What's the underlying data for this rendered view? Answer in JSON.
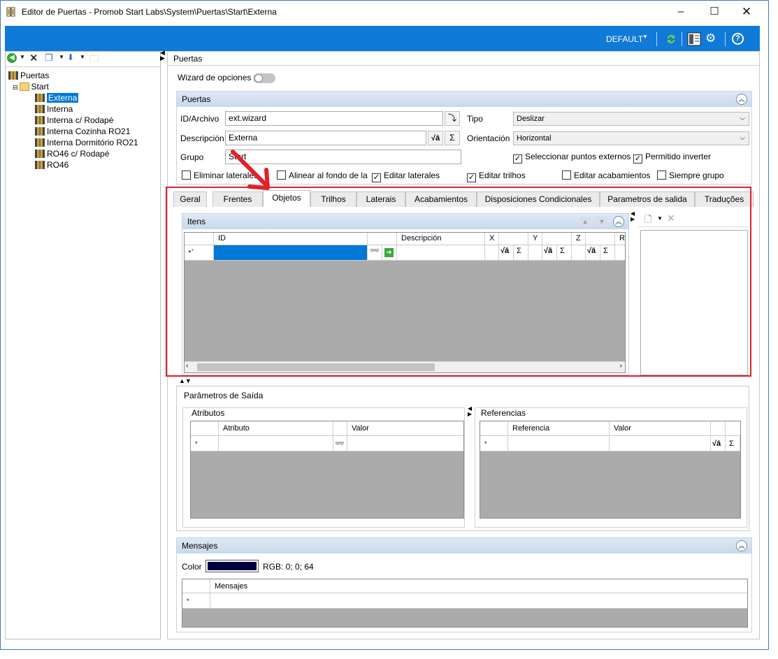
{
  "window": {
    "title": "Editor de Puertas - Promob Start Labs\\System\\Puertas\\Start\\Externa"
  },
  "topbar": {
    "profile": "DEFAULT"
  },
  "tree": {
    "root": "Puertas",
    "folder": "Start",
    "items": [
      "Externa",
      "Interna",
      "Interna c/ Rodapé",
      "Interna Cozinha RO21",
      "Interna Dormitório RO21",
      "RO46 c/ Rodapé",
      "RO46"
    ]
  },
  "main": {
    "breadcrumb": "Puertas",
    "wizard_label": "Wizard de opciones"
  },
  "puertas": {
    "title": "Puertas",
    "id_label": "ID/Archivo",
    "id_value": "ext.wizard",
    "desc_label": "Descripción",
    "desc_value": "Externa",
    "grupo_label": "Grupo",
    "grupo_value": "Start",
    "tipo_label": "Tipo",
    "tipo_value": "Deslizar",
    "orient_label": "Orientación",
    "orient_value": "Horizontal",
    "chk_sel_puntos": "Seleccionar puntos externos",
    "chk_permitido": "Permitido inverter",
    "chk_eliminar": "Eliminar laterales",
    "chk_alinear": "Alinear al fondo de la",
    "chk_editar_lat": "Editar laterales",
    "chk_editar_trilhos": "Editar trilhos",
    "chk_editar_acab": "Editar acabamientos",
    "chk_siempre": "Siempre grupo"
  },
  "tabs": [
    "Geral",
    "Frentes",
    "Objetos",
    "Trilhos",
    "Laterais",
    "Acabamientos",
    "Disposiciones Condicionales",
    "Parametros de salida",
    "Traduções"
  ],
  "itens": {
    "title": "Itens",
    "columns": {
      "id": "ID",
      "descripcion": "Descripción",
      "x": "X",
      "y": "Y",
      "z": "Z",
      "r": "R"
    }
  },
  "salida": {
    "title": "Parâmetros de Saída",
    "atributos_title": "Atributos",
    "atributo_col": "Atributo",
    "valor_col": "Valor",
    "referencias_title": "Referencias",
    "referencia_col": "Referencia",
    "valor_col2": "Valor"
  },
  "mensajes": {
    "title": "Mensajes",
    "color_label": "Color",
    "color_hex": "#000040",
    "rgb_text": "RGB: 0; 0; 64",
    "col": "Mensajes"
  },
  "colors": {
    "accent": "#0f7ad8",
    "highlight": "#e0202a",
    "selection": "#0078d7"
  }
}
